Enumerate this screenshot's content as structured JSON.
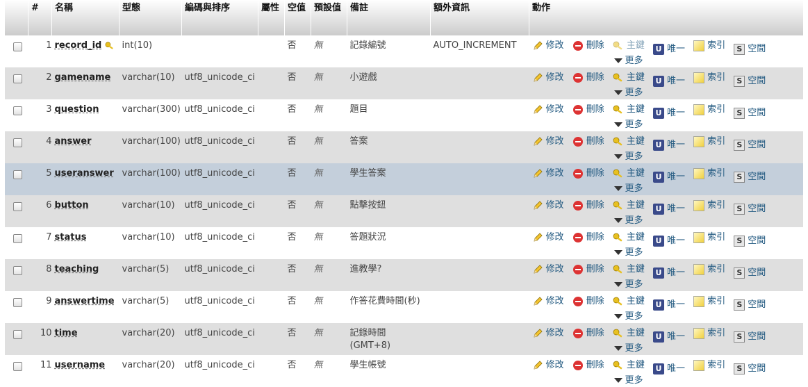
{
  "headers": {
    "num": "#",
    "name": "名稱",
    "type": "型態",
    "collation": "編碼與排序",
    "attributes": "屬性",
    "null": "空值",
    "default": "預設值",
    "comment": "備註",
    "extra": "額外資訊",
    "action": "動作"
  },
  "actions": {
    "change": "修改",
    "drop": "刪除",
    "primary": "主鍵",
    "unique": "唯一",
    "index": "索引",
    "spatial": "空間",
    "more": "更多"
  },
  "rows": [
    {
      "num": "1",
      "name": "record_id",
      "type": "int(10)",
      "collation": "",
      "null": "否",
      "default": "無",
      "comment": "記錄編號",
      "extra": "AUTO_INCREMENT",
      "primary_key": true
    },
    {
      "num": "2",
      "name": "gamename",
      "type": "varchar(10)",
      "collation": "utf8_unicode_ci",
      "null": "否",
      "default": "無",
      "comment": "小遊戲",
      "extra": ""
    },
    {
      "num": "3",
      "name": "question",
      "type": "varchar(300)",
      "collation": "utf8_unicode_ci",
      "null": "否",
      "default": "無",
      "comment": "題目",
      "extra": ""
    },
    {
      "num": "4",
      "name": "answer",
      "type": "varchar(100)",
      "collation": "utf8_unicode_ci",
      "null": "否",
      "default": "無",
      "comment": "答案",
      "extra": ""
    },
    {
      "num": "5",
      "name": "useranswer",
      "type": "varchar(100)",
      "collation": "utf8_unicode_ci",
      "null": "否",
      "default": "無",
      "comment": "學生答案",
      "extra": "",
      "hover": true
    },
    {
      "num": "6",
      "name": "button",
      "type": "varchar(10)",
      "collation": "utf8_unicode_ci",
      "null": "否",
      "default": "無",
      "comment": "點擊按鈕",
      "extra": ""
    },
    {
      "num": "7",
      "name": "status",
      "type": "varchar(10)",
      "collation": "utf8_unicode_ci",
      "null": "否",
      "default": "無",
      "comment": "答題狀況",
      "extra": ""
    },
    {
      "num": "8",
      "name": "teaching",
      "type": "varchar(5)",
      "collation": "utf8_unicode_ci",
      "null": "否",
      "default": "無",
      "comment": "進教學?",
      "extra": ""
    },
    {
      "num": "9",
      "name": "answertime",
      "type": "varchar(5)",
      "collation": "utf8_unicode_ci",
      "null": "否",
      "default": "無",
      "comment": "作答花費時間(秒)",
      "extra": ""
    },
    {
      "num": "10",
      "name": "time",
      "type": "varchar(20)",
      "collation": "utf8_unicode_ci",
      "null": "否",
      "default": "無",
      "comment": "記錄時間\n(GMT+8)",
      "extra": ""
    },
    {
      "num": "11",
      "name": "username",
      "type": "varchar(20)",
      "collation": "utf8_unicode_ci",
      "null": "否",
      "default": "無",
      "comment": "學生帳號",
      "extra": ""
    }
  ],
  "colors": {
    "header_bg_top": "#ffffff",
    "header_bg_bottom": "#cccccc",
    "row_even": "#dfdfdf",
    "row_hover": "#c4cfdb",
    "link": "#235a81"
  }
}
